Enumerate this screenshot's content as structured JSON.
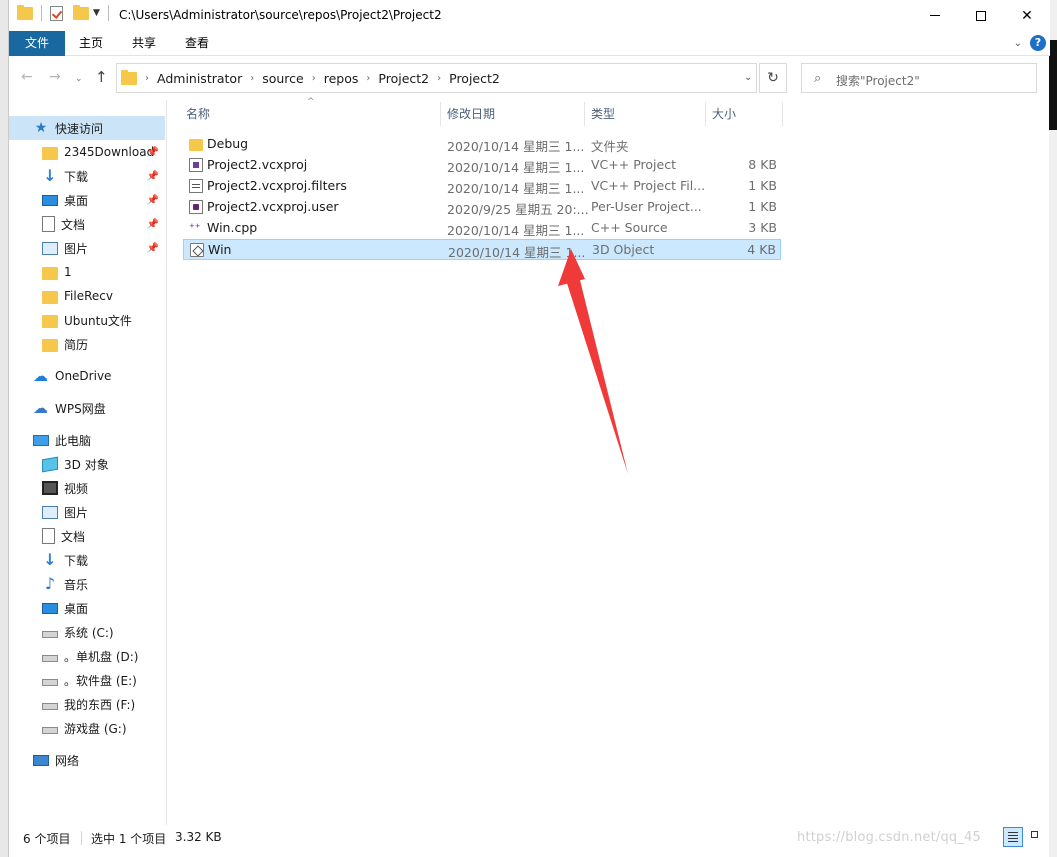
{
  "window": {
    "title_path": "C:\\Users\\Administrator\\source\\repos\\Project2\\Project2",
    "controls": {
      "minimize": "—",
      "maximize": "□",
      "close": "✕"
    }
  },
  "ribbon": {
    "tabs": [
      {
        "label": "文件",
        "active": true
      },
      {
        "label": "主页"
      },
      {
        "label": "共享"
      },
      {
        "label": "查看"
      }
    ],
    "help": "?"
  },
  "address": {
    "crumbs": [
      "Administrator",
      "source",
      "repos",
      "Project2",
      "Project2"
    ],
    "separator": "›"
  },
  "search": {
    "placeholder": "搜索\"Project2\""
  },
  "nav_pane": {
    "quick_access": "快速访问",
    "items": [
      {
        "label": "2345Download",
        "pinned": true
      },
      {
        "label": "下载",
        "pinned": true
      },
      {
        "label": "桌面",
        "pinned": true
      },
      {
        "label": "文档",
        "pinned": true
      },
      {
        "label": "图片",
        "pinned": true
      },
      {
        "label": "1"
      },
      {
        "label": "FileRecv"
      },
      {
        "label": "Ubuntu文件"
      },
      {
        "label": "简历"
      }
    ],
    "onedrive": "OneDrive",
    "wps": "WPS网盘",
    "this_pc": "此电脑",
    "pc_items": [
      {
        "label": "3D 对象"
      },
      {
        "label": "视频"
      },
      {
        "label": "图片"
      },
      {
        "label": "文档"
      },
      {
        "label": "下载"
      },
      {
        "label": "音乐"
      },
      {
        "label": "桌面"
      },
      {
        "label": "系统 (C:)"
      },
      {
        "label": "。单机盘 (D:)"
      },
      {
        "label": "。软件盘 (E:)"
      },
      {
        "label": "我的东西 (F:)"
      },
      {
        "label": "游戏盘 (G:)"
      }
    ],
    "network": "网络"
  },
  "columns": {
    "name": "名称",
    "date": "修改日期",
    "type": "类型",
    "size": "大小"
  },
  "files": [
    {
      "name": "Debug",
      "date": "2020/10/14 星期三 1...",
      "type": "文件夹",
      "size": "",
      "icon": "folder-icon"
    },
    {
      "name": "Project2.vcxproj",
      "date": "2020/10/14 星期三 1...",
      "type": "VC++ Project",
      "size": "8 KB",
      "icon": "vcxproj-icon"
    },
    {
      "name": "Project2.vcxproj.filters",
      "date": "2020/10/14 星期三 1...",
      "type": "VC++ Project Fil...",
      "size": "1 KB",
      "icon": "filters-icon"
    },
    {
      "name": "Project2.vcxproj.user",
      "date": "2020/9/25 星期五 20:...",
      "type": "Per-User Project...",
      "size": "1 KB",
      "icon": "user-file-icon"
    },
    {
      "name": "Win.cpp",
      "date": "2020/10/14 星期三 1...",
      "type": "C++ Source",
      "size": "3 KB",
      "icon": "cpp-icon"
    },
    {
      "name": "Win",
      "date": "2020/10/14 星期三 1...",
      "type": "3D Object",
      "size": "4 KB",
      "icon": "3d-object-icon",
      "selected": true
    }
  ],
  "status": {
    "item_count": "6 个项目",
    "selected": "选中 1 个项目",
    "selected_size": "3.32 KB"
  },
  "watermark": "https://blog.csdn.net/qq_45",
  "colors": {
    "accent": "#19689f",
    "selection": "#cce8ff",
    "annotation": "#f03a3a"
  }
}
